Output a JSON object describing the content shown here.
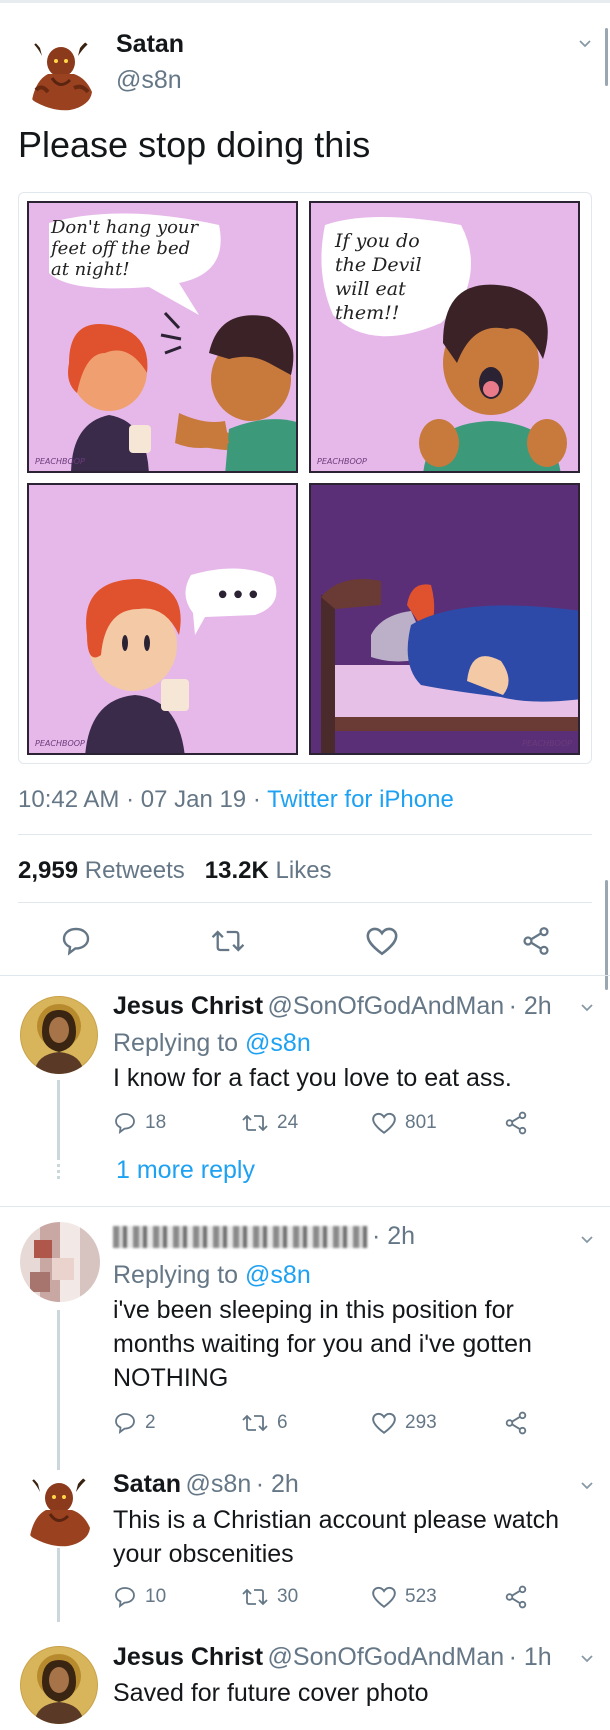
{
  "main_tweet": {
    "author_name": "Satan",
    "author_handle": "@s8n",
    "text": "Please stop doing this",
    "comic": {
      "panel1_speech": "Don't hang your feet off the bed at night!",
      "panel2_speech": "If you do the Devil will eat them!!",
      "panel3_speech": "•••",
      "artist_signature": "PEACHBOOP"
    },
    "time": "10:42 AM",
    "date": "07 Jan 19",
    "source": "Twitter for iPhone",
    "retweets_count": "2,959",
    "retweets_label": "Retweets",
    "likes_count": "13.2K",
    "likes_label": "Likes"
  },
  "replies": [
    {
      "author_name": "Jesus Christ",
      "author_handle": "@SonOfGodAndMan",
      "time": "· 2h",
      "replying_label": "Replying to",
      "replying_to": "@s8n",
      "text": "I know for a fact you love to eat ass.",
      "reply_count": "18",
      "retweet_count": "24",
      "like_count": "801",
      "more_replies": "1 more reply"
    },
    {
      "author_name": "",
      "author_handle": "",
      "time": "· 2h",
      "replying_label": "Replying to",
      "replying_to": "@s8n",
      "text": "i've been sleeping in this position for months waiting for you and i've gotten NOTHING",
      "reply_count": "2",
      "retweet_count": "6",
      "like_count": "293"
    },
    {
      "author_name": "Satan",
      "author_handle": "@s8n",
      "time": "· 2h",
      "text": "This is a Christian account please watch your obscenities",
      "reply_count": "10",
      "retweet_count": "30",
      "like_count": "523"
    },
    {
      "author_name": "Jesus Christ",
      "author_handle": "@SonOfGodAndMan",
      "time": "· 1h",
      "text": "Saved for future cover photo"
    }
  ],
  "colors": {
    "accent": "#1da1f2",
    "text": "#14171a",
    "secondary": "#657786",
    "divider": "#e1e8ed",
    "comic_lilac": "#e6b8ea",
    "comic_night": "#5b2f78"
  },
  "icons": [
    "chevron-down-icon",
    "reply-icon",
    "retweet-icon",
    "like-icon",
    "share-icon"
  ]
}
